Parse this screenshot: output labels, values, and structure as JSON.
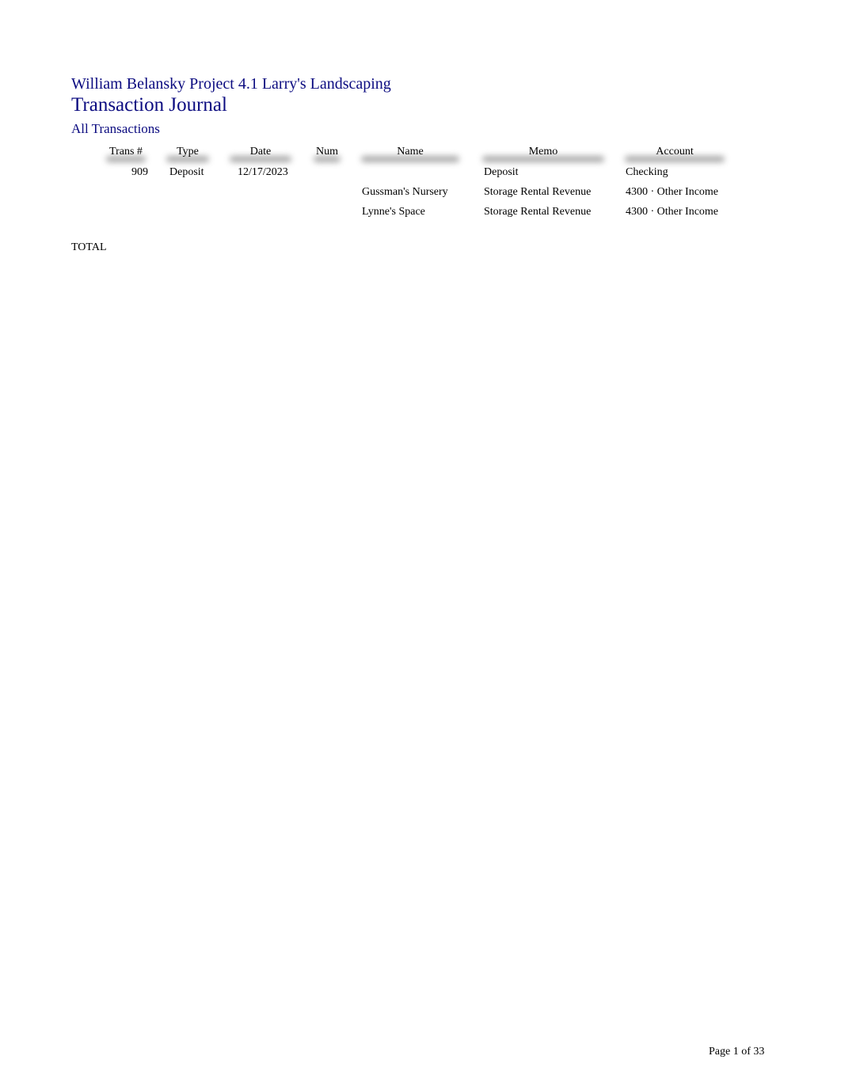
{
  "report": {
    "company": "William Belansky Project 4.1 Larry's Landscaping",
    "title": "Transaction Journal",
    "subtitle": "All Transactions"
  },
  "table": {
    "columns": [
      "Trans #",
      "Type",
      "Date",
      "Num",
      "Name",
      "Memo",
      "Account"
    ],
    "rows": [
      {
        "trans": "909",
        "type": "Deposit",
        "date": "12/17/2023",
        "num": "",
        "name": "",
        "memo": "Deposit",
        "account": "Checking"
      },
      {
        "trans": "",
        "type": "",
        "date": "",
        "num": "",
        "name": "Gussman's Nursery",
        "memo": "Storage Rental Revenue",
        "account": "4300 · Other Income"
      },
      {
        "trans": "",
        "type": "",
        "date": "",
        "num": "",
        "name": "Lynne's Space",
        "memo": "Storage Rental Revenue",
        "account": "4300 · Other Income"
      }
    ],
    "total_label": "TOTAL"
  },
  "footer": {
    "page": "Page 1 of 33"
  }
}
